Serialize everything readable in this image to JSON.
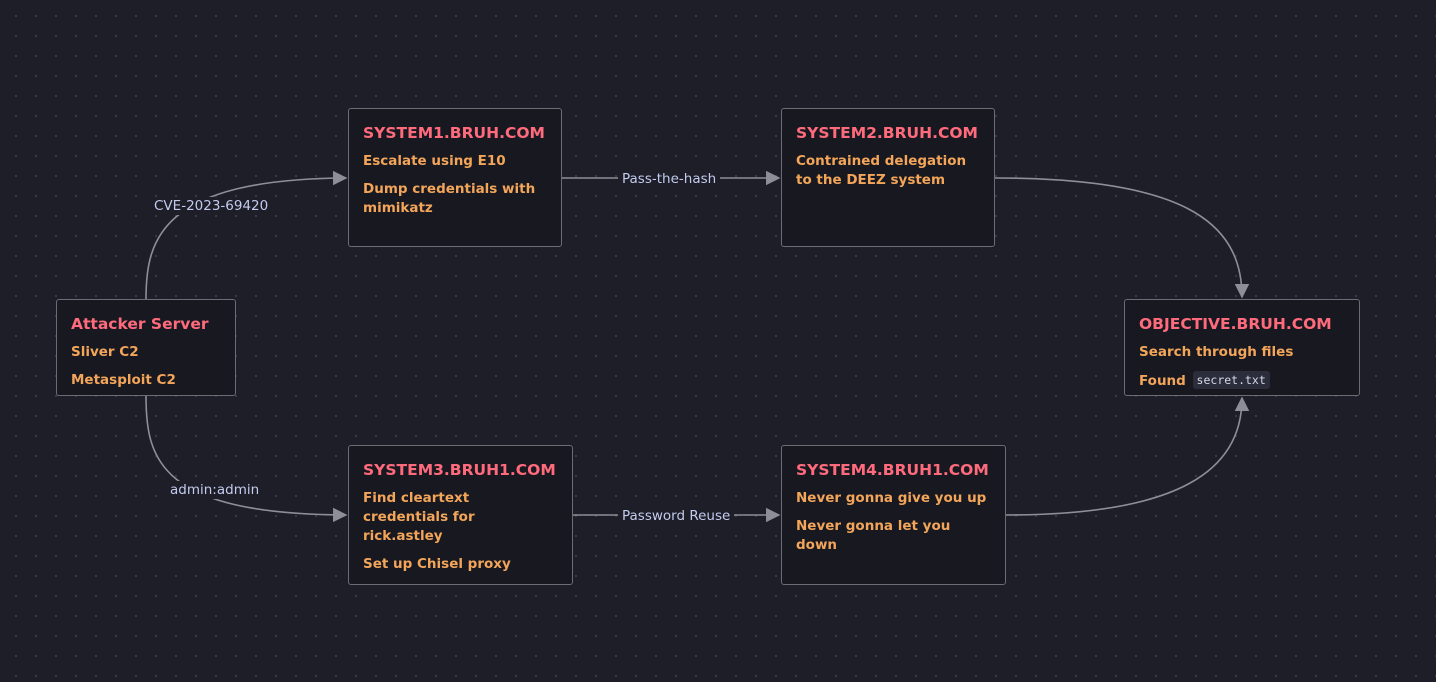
{
  "diagram": {
    "colors": {
      "background": "#1d1e27",
      "node_fill": "#181920",
      "node_border": "#6b6c74",
      "title": "#ff6b7d",
      "text": "#f3a55a",
      "edge": "#8e8f96",
      "edge_label": "#c3cbef"
    },
    "nodes": {
      "attacker": {
        "title": "Attacker Server",
        "lines": [
          "Sliver C2",
          "Metasploit C2"
        ]
      },
      "system1": {
        "title": "SYSTEM1.BRUH.COM",
        "lines": [
          "Escalate using E10",
          "Dump credentials with mimikatz"
        ]
      },
      "system2": {
        "title": "SYSTEM2.BRUH.COM",
        "lines": [
          "Contrained delegation to the DEEZ system"
        ]
      },
      "system3": {
        "title": "SYSTEM3.BRUH1.COM",
        "lines": [
          "Find cleartext credentials for rick.astley",
          "Set up Chisel proxy"
        ]
      },
      "system4": {
        "title": "SYSTEM4.BRUH1.COM",
        "lines": [
          "Never gonna give you up",
          "Never gonna let you down"
        ]
      },
      "objective": {
        "title": "OBJECTIVE.BRUH.COM",
        "lines": [
          "Search through files",
          "Found"
        ],
        "code": "secret.txt"
      }
    },
    "edges": [
      {
        "from": "Attacker Server",
        "to": "SYSTEM1.BRUH.COM",
        "label": "CVE-2023-69420"
      },
      {
        "from": "Attacker Server",
        "to": "SYSTEM3.BRUH1.COM",
        "label": "admin:admin"
      },
      {
        "from": "SYSTEM1.BRUH.COM",
        "to": "SYSTEM2.BRUH.COM",
        "label": "Pass-the-hash"
      },
      {
        "from": "SYSTEM3.BRUH1.COM",
        "to": "SYSTEM4.BRUH1.COM",
        "label": "Password Reuse"
      },
      {
        "from": "SYSTEM2.BRUH.COM",
        "to": "OBJECTIVE.BRUH.COM",
        "label": ""
      },
      {
        "from": "SYSTEM4.BRUH1.COM",
        "to": "OBJECTIVE.BRUH.COM",
        "label": ""
      }
    ]
  }
}
